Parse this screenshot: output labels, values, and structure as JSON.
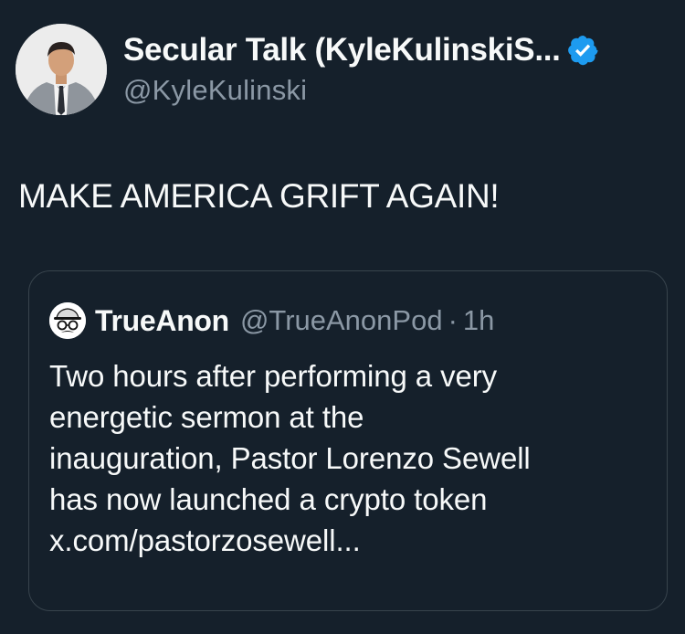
{
  "tweet": {
    "author": {
      "display_name": "Secular Talk (KyleKulinskiS...",
      "handle": "@KyleKulinski",
      "verified": true,
      "verified_color": "#1d9bf0"
    },
    "text": "MAKE AMERICA GRIFT AGAIN!"
  },
  "quoted_tweet": {
    "author": {
      "display_name": "TrueAnon",
      "handle": "@TrueAnonPod",
      "separator": "·",
      "time": "1h"
    },
    "lines": [
      "Two hours after performing a very",
      "energetic sermon at the",
      "inauguration, Pastor Lorenzo Sewell",
      "has now launched a crypto token",
      "x.com/pastorzosewell..."
    ]
  },
  "colors": {
    "background": "#15202b",
    "text": "#f7f9f9",
    "secondary_text": "#8b98a5",
    "border": "#38444d"
  }
}
